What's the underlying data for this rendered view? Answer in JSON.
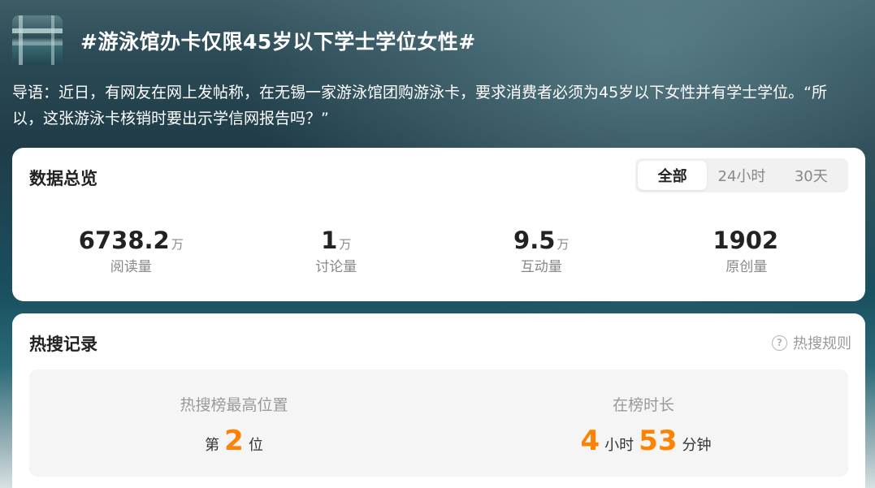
{
  "topic": {
    "title": "#游泳馆办卡仅限45岁以下学士学位女性#",
    "intro": "导语：近日，有网友在网上发帖称，在无锡一家游泳馆团购游泳卡，要求消费者必须为45岁以下女性并有学士学位。“所以，这张游泳卡核销时要出示学信网报告吗？”"
  },
  "overview": {
    "title": "数据总览",
    "tabs": [
      "全部",
      "24小时",
      "30天"
    ],
    "active_tab": "全部",
    "stats": [
      {
        "value": "6738.2",
        "unit": "万",
        "label": "阅读量"
      },
      {
        "value": "1",
        "unit": "万",
        "label": "讨论量"
      },
      {
        "value": "9.5",
        "unit": "万",
        "label": "互动量"
      },
      {
        "value": "1902",
        "unit": "",
        "label": "原创量"
      }
    ]
  },
  "hot": {
    "title": "热搜记录",
    "rule_link": "热搜规则",
    "peak": {
      "label": "热搜榜最高位置",
      "prefix": "第",
      "value": "2",
      "suffix": "位"
    },
    "duration": {
      "label": "在榜时长",
      "hours": "4",
      "hours_unit": "小时",
      "minutes": "53",
      "minutes_unit": "分钟"
    }
  },
  "colors": {
    "accent": "#ff8200"
  },
  "icons": {
    "thumbnail": "pool-thumbnail",
    "help": "question-circle-icon"
  }
}
